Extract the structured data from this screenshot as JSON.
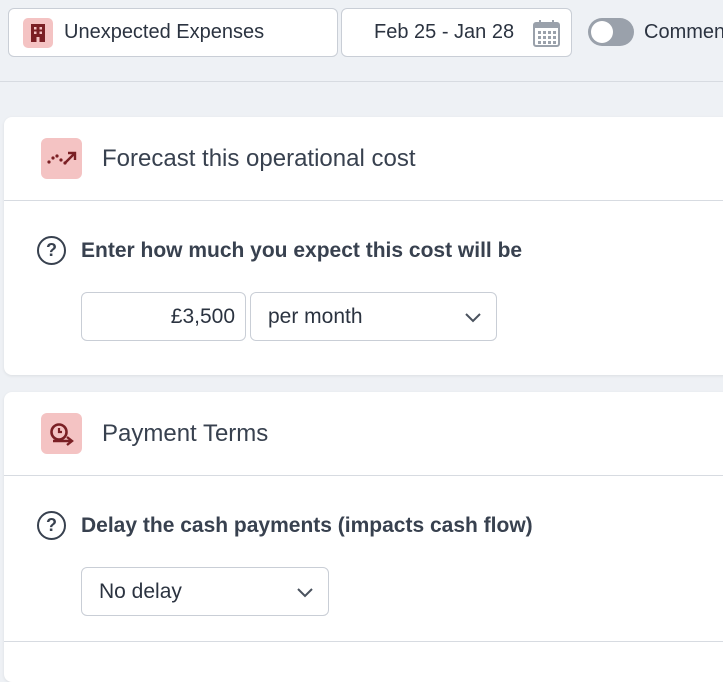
{
  "topbar": {
    "expense_name": "Unexpected Expenses",
    "date_range": "Feb 25 - Jan 28",
    "toggle_label": "Comments",
    "toggle_on": false
  },
  "forecast": {
    "title": "Forecast this operational cost",
    "question": "Enter how much you expect this cost will be",
    "amount": "£3,500",
    "frequency": "per month"
  },
  "payment_terms": {
    "title": "Payment Terms",
    "question": "Delay the cash payments (impacts cash flow)",
    "delay": "No delay"
  },
  "icons": {
    "expense": "building-icon",
    "calendar": "calendar-icon",
    "forecast": "trend-arrow-icon",
    "payment": "payment-terms-icon",
    "help": "question-icon",
    "dropdown": "chevron-down-icon"
  },
  "colors": {
    "accent_bg": "#f4c3c3",
    "accent_fg": "#7a1f24",
    "page_bg": "#eef1f5"
  }
}
